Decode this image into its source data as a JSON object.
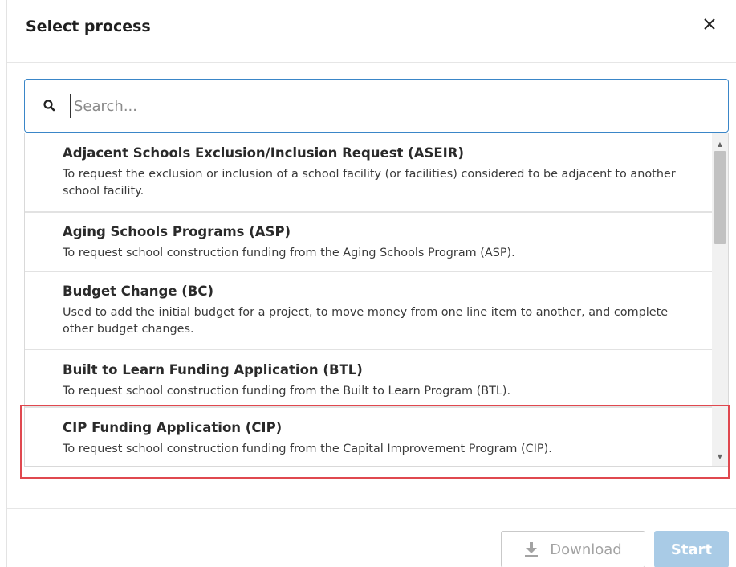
{
  "dialog": {
    "title": "Select process",
    "close_icon": "close-icon"
  },
  "search": {
    "placeholder": "Search...",
    "value": "",
    "icon": "search-icon"
  },
  "processes": [
    {
      "title": "Adjacent Schools Exclusion/Inclusion Request (ASEIR)",
      "description": "To request the exclusion or inclusion of a school facility (or facilities) considered to be adjacent to another school facility."
    },
    {
      "title": "Aging Schools Programs (ASP)",
      "description": "To request school construction funding from the Aging Schools Program (ASP)."
    },
    {
      "title": "Budget Change (BC)",
      "description": "Used to add the initial budget for a project, to move money from one line item to another, and complete other budget changes."
    },
    {
      "title": "Built to Learn Funding Application (BTL)",
      "description": "To request school construction funding from the Built to Learn Program (BTL)."
    },
    {
      "title": "CIP Funding Application (CIP)",
      "description": "To request school construction funding from the Capital Improvement Program (CIP)."
    }
  ],
  "footer": {
    "download_label": "Download",
    "download_icon": "download-icon",
    "start_label": "Start"
  },
  "colors": {
    "accent": "#3a86c8",
    "start_button": "#a9cbe6",
    "highlight": "#e0484f"
  }
}
